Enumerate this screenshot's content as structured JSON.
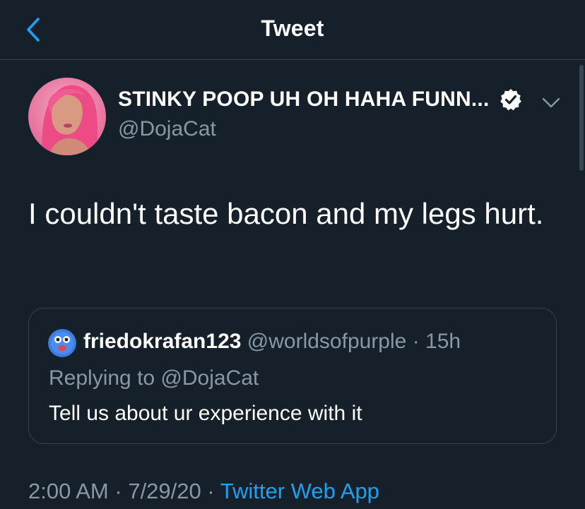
{
  "header": {
    "title": "Tweet",
    "back_icon": "chevron-left-icon"
  },
  "tweet": {
    "author_name": "STINKY POOP UH OH HAHA FUNN...",
    "author_handle": "@DojaCat",
    "verified": true,
    "text": "I couldn't taste bacon and my legs hurt.",
    "time": "2:00 AM",
    "separator": "·",
    "date": "7/29/20",
    "source": "Twitter Web App"
  },
  "quoted_tweet": {
    "author_name": "friedokrafan123",
    "author_handle": "@worldsofpurple",
    "separator": "·",
    "time_ago": "15h",
    "replying_to": "Replying to @DojaCat",
    "text": "Tell us about ur experience with it"
  },
  "colors": {
    "background": "#15202b",
    "accent": "#1da1f2",
    "secondary_text": "#8899a6",
    "divider": "#38444d"
  }
}
